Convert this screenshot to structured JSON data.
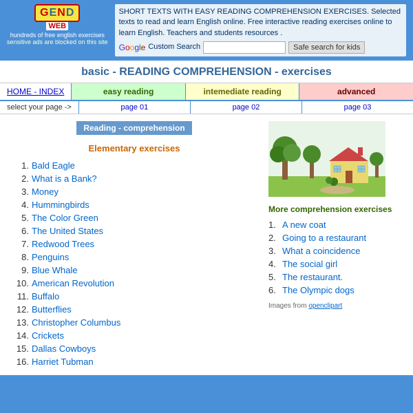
{
  "top": {
    "logo_letters": "GEND",
    "logo_web": "WEB",
    "logo_sub": "hundreds of free english exercises",
    "sensitive_ads": "sensitive ads are blocked on this site",
    "description": "SHORT TEXTS WITH EASY READING COMPREHENSION EXERCISES. Selected texts to read and learn English online. Free interactive reading exercises online to learn English. Teachers and students resources .",
    "search_label": "Custom Search",
    "safe_search_btn": "Safe search for kids"
  },
  "page_title": "basic - READING COMPREHENSION - exercises",
  "nav": {
    "home_label": "HOME - INDEX",
    "select_label": "select your page ->",
    "easy_label": "easy reading",
    "intermediate_label": "intemediate reading",
    "advanced_label": "advanced",
    "page01": "page 01",
    "page02": "page 02",
    "page03": "page 03",
    "section_label": "Reading - comprehension"
  },
  "elementary": {
    "header": "Elementary exercises",
    "items": [
      {
        "num": "1.",
        "label": "Bald Eagle"
      },
      {
        "num": "2.",
        "label": "What is a Bank?"
      },
      {
        "num": "3.",
        "label": "Money"
      },
      {
        "num": "4.",
        "label": "Hummingbirds"
      },
      {
        "num": "5.",
        "label": "The Color Green"
      },
      {
        "num": "6.",
        "label": "The United States"
      },
      {
        "num": "7.",
        "label": "Redwood Trees"
      },
      {
        "num": "8.",
        "label": "Penguins"
      },
      {
        "num": "9.",
        "label": "Blue Whale"
      },
      {
        "num": "10.",
        "label": "American Revolution"
      },
      {
        "num": "11.",
        "label": "Buffalo"
      },
      {
        "num": "12.",
        "label": "Butterflies"
      },
      {
        "num": "13.",
        "label": "Christopher Columbus"
      },
      {
        "num": "14.",
        "label": "Crickets"
      },
      {
        "num": "15.",
        "label": "Dallas Cowboys"
      },
      {
        "num": "16.",
        "label": "Harriet Tubman"
      }
    ]
  },
  "more": {
    "header": "More comprehension exercises",
    "items": [
      {
        "num": "1.",
        "label": "A new coat"
      },
      {
        "num": "2.",
        "label": "Going to a restaurant"
      },
      {
        "num": "3.",
        "label": "What a coincidence"
      },
      {
        "num": "4.",
        "label": "The social girl"
      },
      {
        "num": "5.",
        "label": "The restaurant."
      },
      {
        "num": "6.",
        "label": "The Olympic dogs"
      }
    ],
    "credit": "Images from",
    "credit_link": "openclipart"
  }
}
